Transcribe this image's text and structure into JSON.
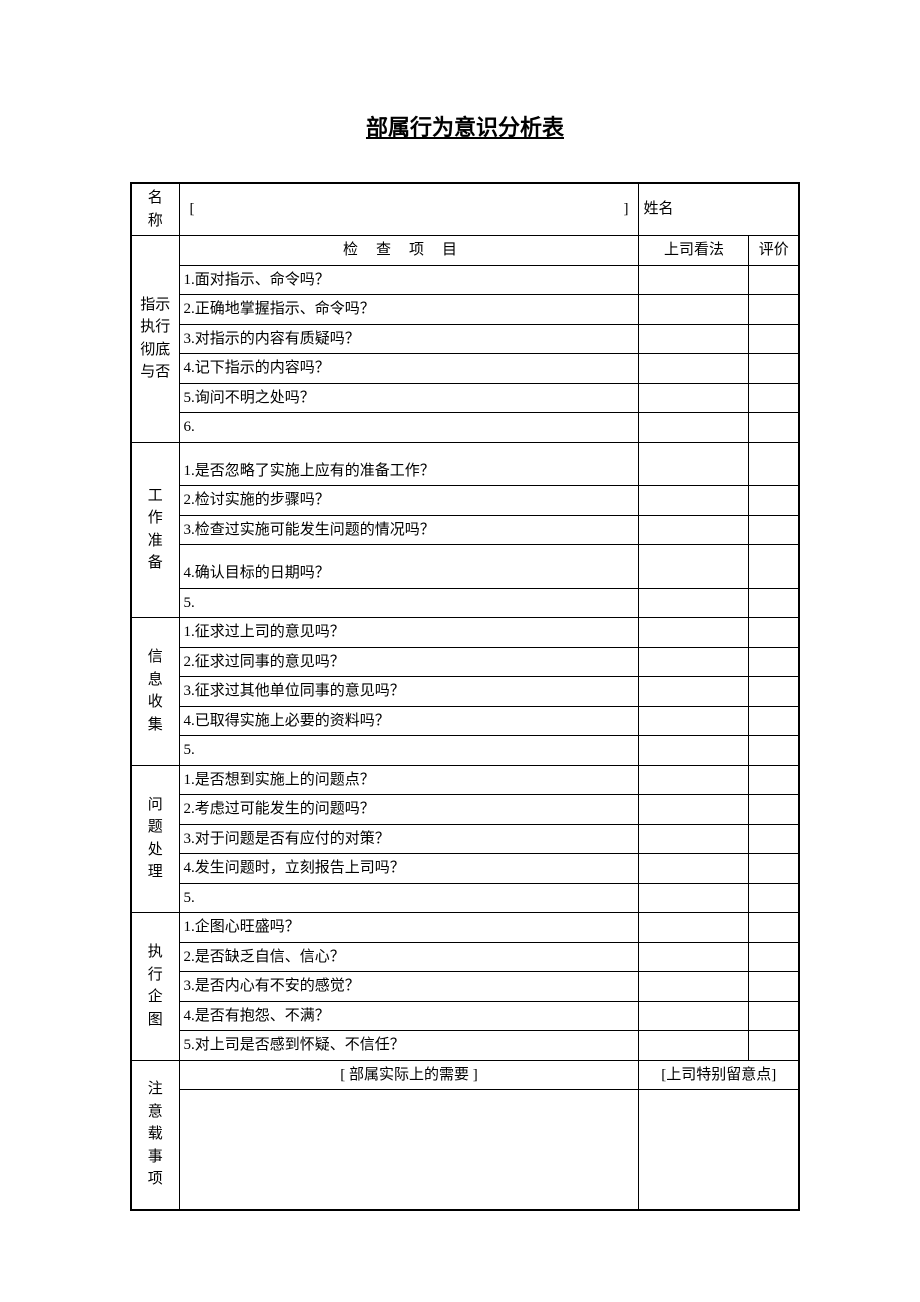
{
  "title": "部属行为意识分析表",
  "header": {
    "name_label": "名称",
    "name_value_open": "[",
    "name_value_close": "]",
    "person_label": "姓名",
    "person_value": ""
  },
  "columns": {
    "check": "检查项目",
    "boss": "上司看法",
    "eval": "评价"
  },
  "sections": [
    {
      "label": "指示执行彻底与否",
      "chars": [
        "指示",
        "执行",
        "彻底",
        "与否"
      ],
      "rows": [
        "1.面对指示、命令吗？",
        "2.正确地掌握指示、命令吗？",
        "3.对指示的内容有质疑吗？",
        "4.记下指示的内容吗？",
        "5.询问不明之处吗？",
        "6."
      ]
    },
    {
      "label": "工作准备",
      "chars": [
        "工",
        "作",
        "准",
        "备"
      ],
      "rows": [
        "1.是否忽略了实施上应有的准备工作？",
        "2.检讨实施的步骤吗？",
        "3.检查过实施可能发生问题的情况吗？",
        "4.确认目标的日期吗？",
        "5."
      ],
      "pad_first": true,
      "pad_before_4": true
    },
    {
      "label": "信息收集",
      "chars": [
        "信",
        "息",
        "收",
        "集"
      ],
      "rows": [
        "1.征求过上司的意见吗？",
        "2.征求过同事的意见吗？",
        "3.征求过其他单位同事的意见吗？",
        "4.已取得实施上必要的资料吗？",
        "5."
      ]
    },
    {
      "label": "问题处理",
      "chars": [
        "问",
        "题",
        "处",
        "理"
      ],
      "rows": [
        "1.是否想到实施上的问题点？",
        "2.考虑过可能发生的问题吗？",
        "3.对于问题是否有应付的对策？",
        "4.发生问题时，立刻报告上司吗？",
        "5."
      ]
    },
    {
      "label": "执行企图",
      "chars": [
        "执",
        "行",
        "企",
        "图"
      ],
      "rows": [
        "1.企图心旺盛吗？",
        "2.是否缺乏自信、信心？",
        "3.是否内心有不安的感觉？",
        "4.是否有抱怨、不满？",
        "5.对上司是否感到怀疑、不信任？"
      ]
    }
  ],
  "footer": {
    "label_chars": [
      "注",
      "意",
      "载",
      "事",
      "项"
    ],
    "left_header": "[ 部属实际上的需要   ]",
    "right_header": "[上司特别留意点]"
  }
}
